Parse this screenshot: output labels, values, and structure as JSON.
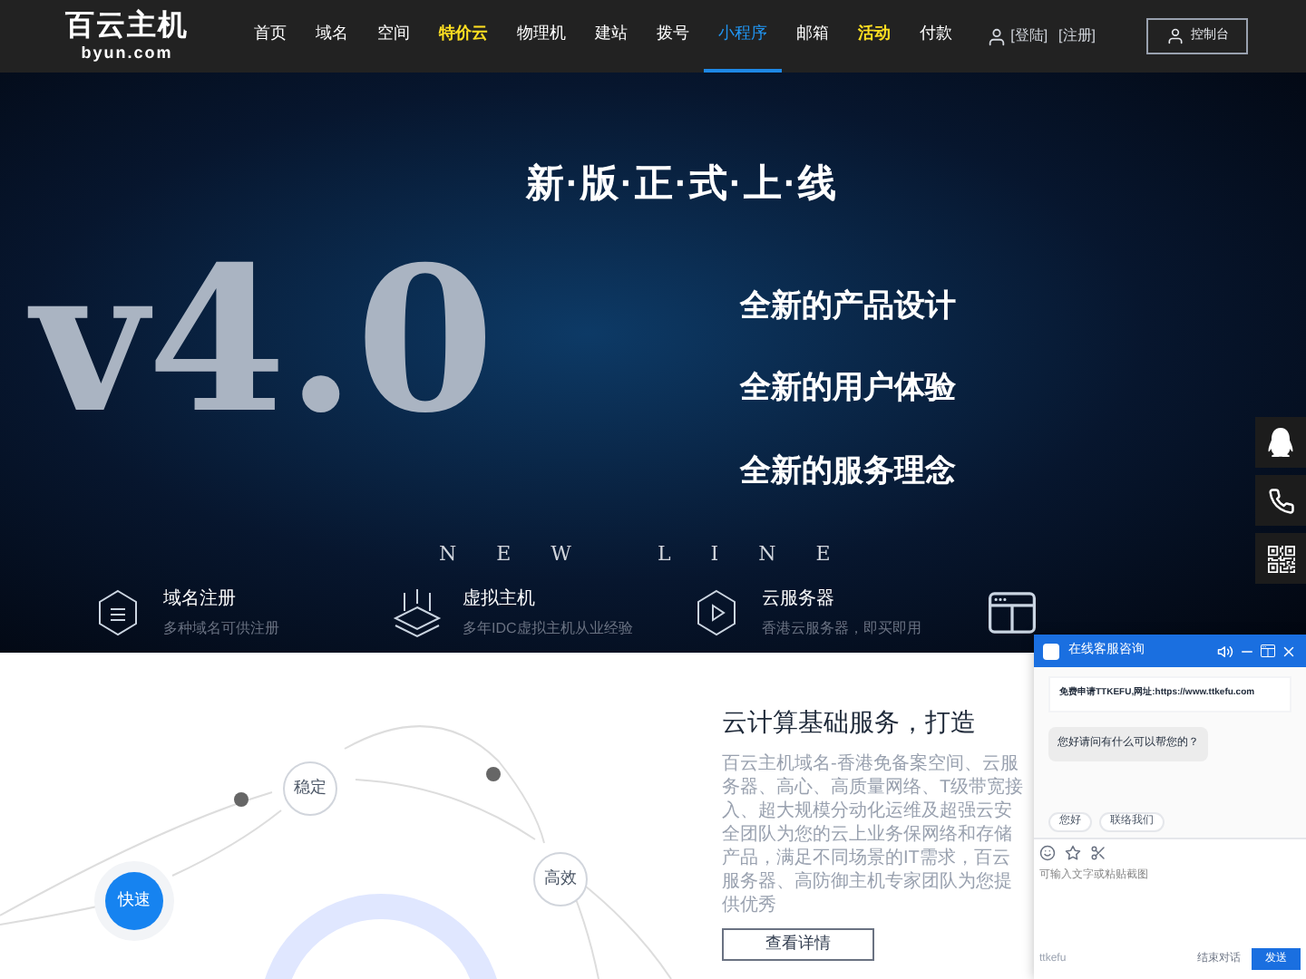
{
  "header": {
    "logo": {
      "name": "百云主机",
      "domain": "byun.com"
    },
    "nav": [
      {
        "label": "首页",
        "selected": false,
        "highlight": false
      },
      {
        "label": "域名",
        "selected": false,
        "highlight": false
      },
      {
        "label": "空间",
        "selected": false,
        "highlight": false
      },
      {
        "label": "特价云",
        "selected": false,
        "highlight": true
      },
      {
        "label": "物理机",
        "selected": false,
        "highlight": false
      },
      {
        "label": "建站",
        "selected": false,
        "highlight": false
      },
      {
        "label": "拨号",
        "selected": false,
        "highlight": false
      },
      {
        "label": "小程序",
        "selected": true,
        "highlight": false
      },
      {
        "label": "邮箱",
        "selected": false,
        "highlight": false
      },
      {
        "label": "活动",
        "selected": false,
        "highlight": true
      },
      {
        "label": "付款",
        "selected": false,
        "highlight": false
      }
    ],
    "login": "[登陆]",
    "register": "[注册]",
    "console": "控制台"
  },
  "banner": {
    "big_title": "v4.0",
    "headline": "新·版·正·式·上·线",
    "taglines": [
      "全新的产品设计",
      "全新的用户体验",
      "全新的服务理念"
    ],
    "subtitle": "NEW LINE",
    "features": [
      {
        "kind": "domain",
        "title": "域名注册",
        "desc": "多种域名可供注册"
      },
      {
        "kind": "hosting",
        "title": "虚拟主机",
        "desc": "多年IDC虚拟主机从业经验"
      },
      {
        "kind": "cloud",
        "title": "云服务器",
        "desc": "香港云服务器，即买即用"
      },
      {
        "kind": "window"
      }
    ]
  },
  "diagram": {
    "nodes": [
      {
        "label": "稳定",
        "selected": false
      },
      {
        "label": "快速",
        "selected": true
      },
      {
        "label": "高效",
        "selected": false
      }
    ]
  },
  "intro": {
    "title": "云计算基础服务，打造",
    "lines": [
      "百云主机域名-香港免备案空间、云服务器、高",
      "心、高质量网络、T级带宽接入、超大规模分",
      "动化运维及超强云安全团队为您的云上业务保",
      "网络和存储产品，满足不同场景的IT需求，百",
      "云服务器、高防御主机专家团队为您提供优秀"
    ],
    "button": "查看详情"
  },
  "chat": {
    "title": "在线客服咨询",
    "notice": "免费申请TTKEFU,网址:https://www.ttkefu.com",
    "message": "您好请问有什么可以帮您的？",
    "quick_replies": [
      "您好",
      "联络我们"
    ],
    "placeholder": "可输入文字或粘贴截图",
    "brand": "ttkefu",
    "end": "结束对话",
    "send": "发送"
  }
}
